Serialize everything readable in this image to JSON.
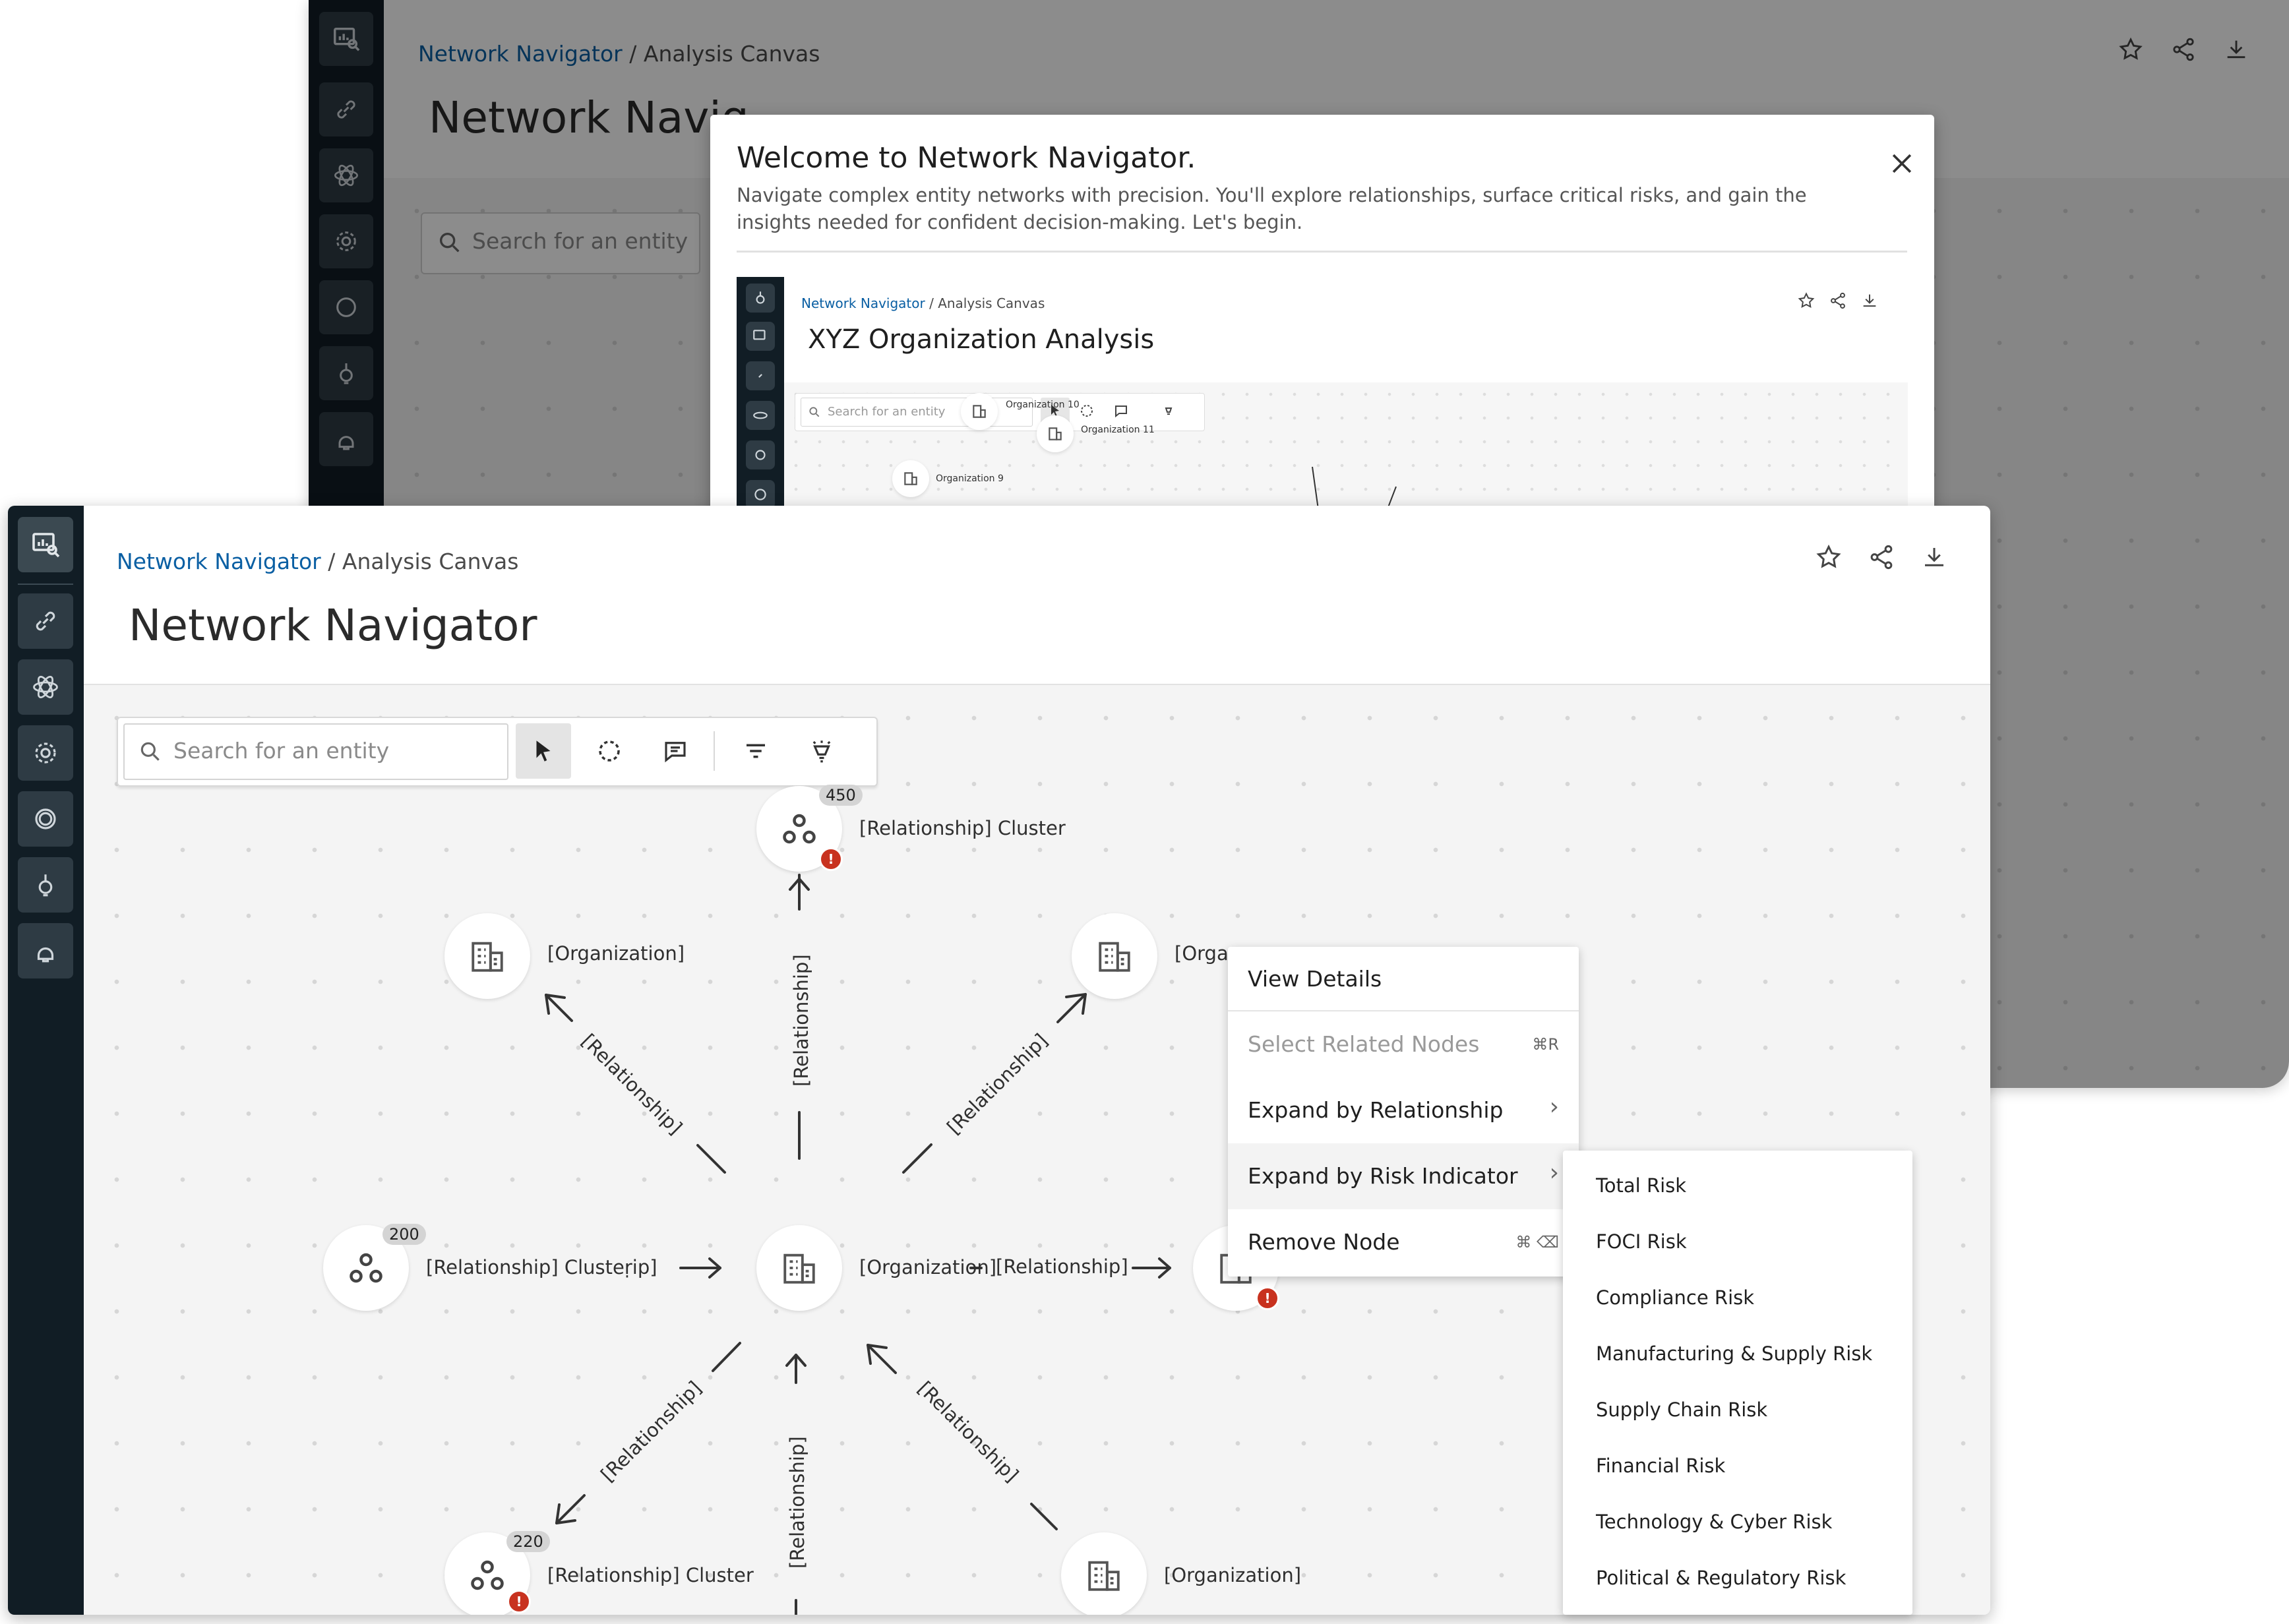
{
  "window": {
    "breadcrumb": {
      "link": "Network Navigator",
      "sep": "/",
      "current": "Analysis Canvas"
    },
    "title": "Network Navigator",
    "search_placeholder": "Search for an entity"
  },
  "back_window": {
    "breadcrumb": {
      "link": "Network Navigator",
      "sep": "/",
      "current": "Analysis Canvas"
    },
    "title_visible": "Network Navig",
    "search_placeholder": "Search for an entity",
    "welcome": {
      "title": "Welcome to Network Navigator.",
      "line1": "Navigate complex entity networks with precision. You'll explore relationships, surface critical risks, and gain the",
      "line2": "insights needed for confident decision-making. Let's begin.",
      "preview": {
        "breadcrumb_link": "Network Navigator",
        "breadcrumb_current": "/ Analysis Canvas",
        "title": "XYZ Organization Analysis",
        "search_placeholder": "Search for an entity",
        "nodes": [
          "Organization 10",
          "Organization 11",
          "Organization 9"
        ]
      }
    }
  },
  "graph": {
    "center_label": "[Organization]",
    "center_edge_label": "[Relationship]",
    "top_cluster": {
      "label": "[Relationship] Cluster",
      "count": "450"
    },
    "top_left_org": "[Organization]",
    "top_right_org": "[Organ",
    "left_cluster": {
      "label": "[Relationship] Clusteṛip]",
      "count": "200"
    },
    "bottom_left_cluster": {
      "label": "[Relationship] Cluster",
      "count": "220"
    },
    "bottom_right_org": "[Organization]",
    "relationship": "[Relationship]",
    "alert_symbol": "!"
  },
  "context_menu": {
    "items": [
      {
        "label": "View Details",
        "shortcut": "",
        "disabled": false
      },
      {
        "label": "Select Related Nodes",
        "shortcut": "⌘R",
        "disabled": true
      },
      {
        "label": "Expand by Relationship",
        "shortcut": "›",
        "disabled": false
      },
      {
        "label": "Expand by Risk Indicator",
        "shortcut": "›",
        "disabled": false
      },
      {
        "label": "Remove Node",
        "shortcut": "⌘ ⌫",
        "disabled": false
      }
    ]
  },
  "submenu": {
    "items": [
      "Total Risk",
      "FOCI  Risk",
      "Compliance Risk",
      "Manufacturing & Supply Risk",
      "Supply Chain Risk",
      "Financial Risk",
      "Technology & Cyber Risk",
      "Political & Regulatory Risk"
    ]
  },
  "icons": [
    "analysis-icon",
    "link-icon",
    "atom-icon",
    "gear-icon",
    "circle-icon",
    "bulb-icon",
    "brain-icon",
    "star-icon",
    "share-icon",
    "download-icon",
    "search-icon",
    "pointer-icon",
    "lasso-icon",
    "comment-icon",
    "filter-icon",
    "lightbulb-icon",
    "building-icon",
    "cluster-icon",
    "close-icon"
  ],
  "colors": {
    "sidebar": "#111d25",
    "link": "#0a5fa3",
    "alert": "#c8321f",
    "canvas": "#f4f4f4"
  }
}
